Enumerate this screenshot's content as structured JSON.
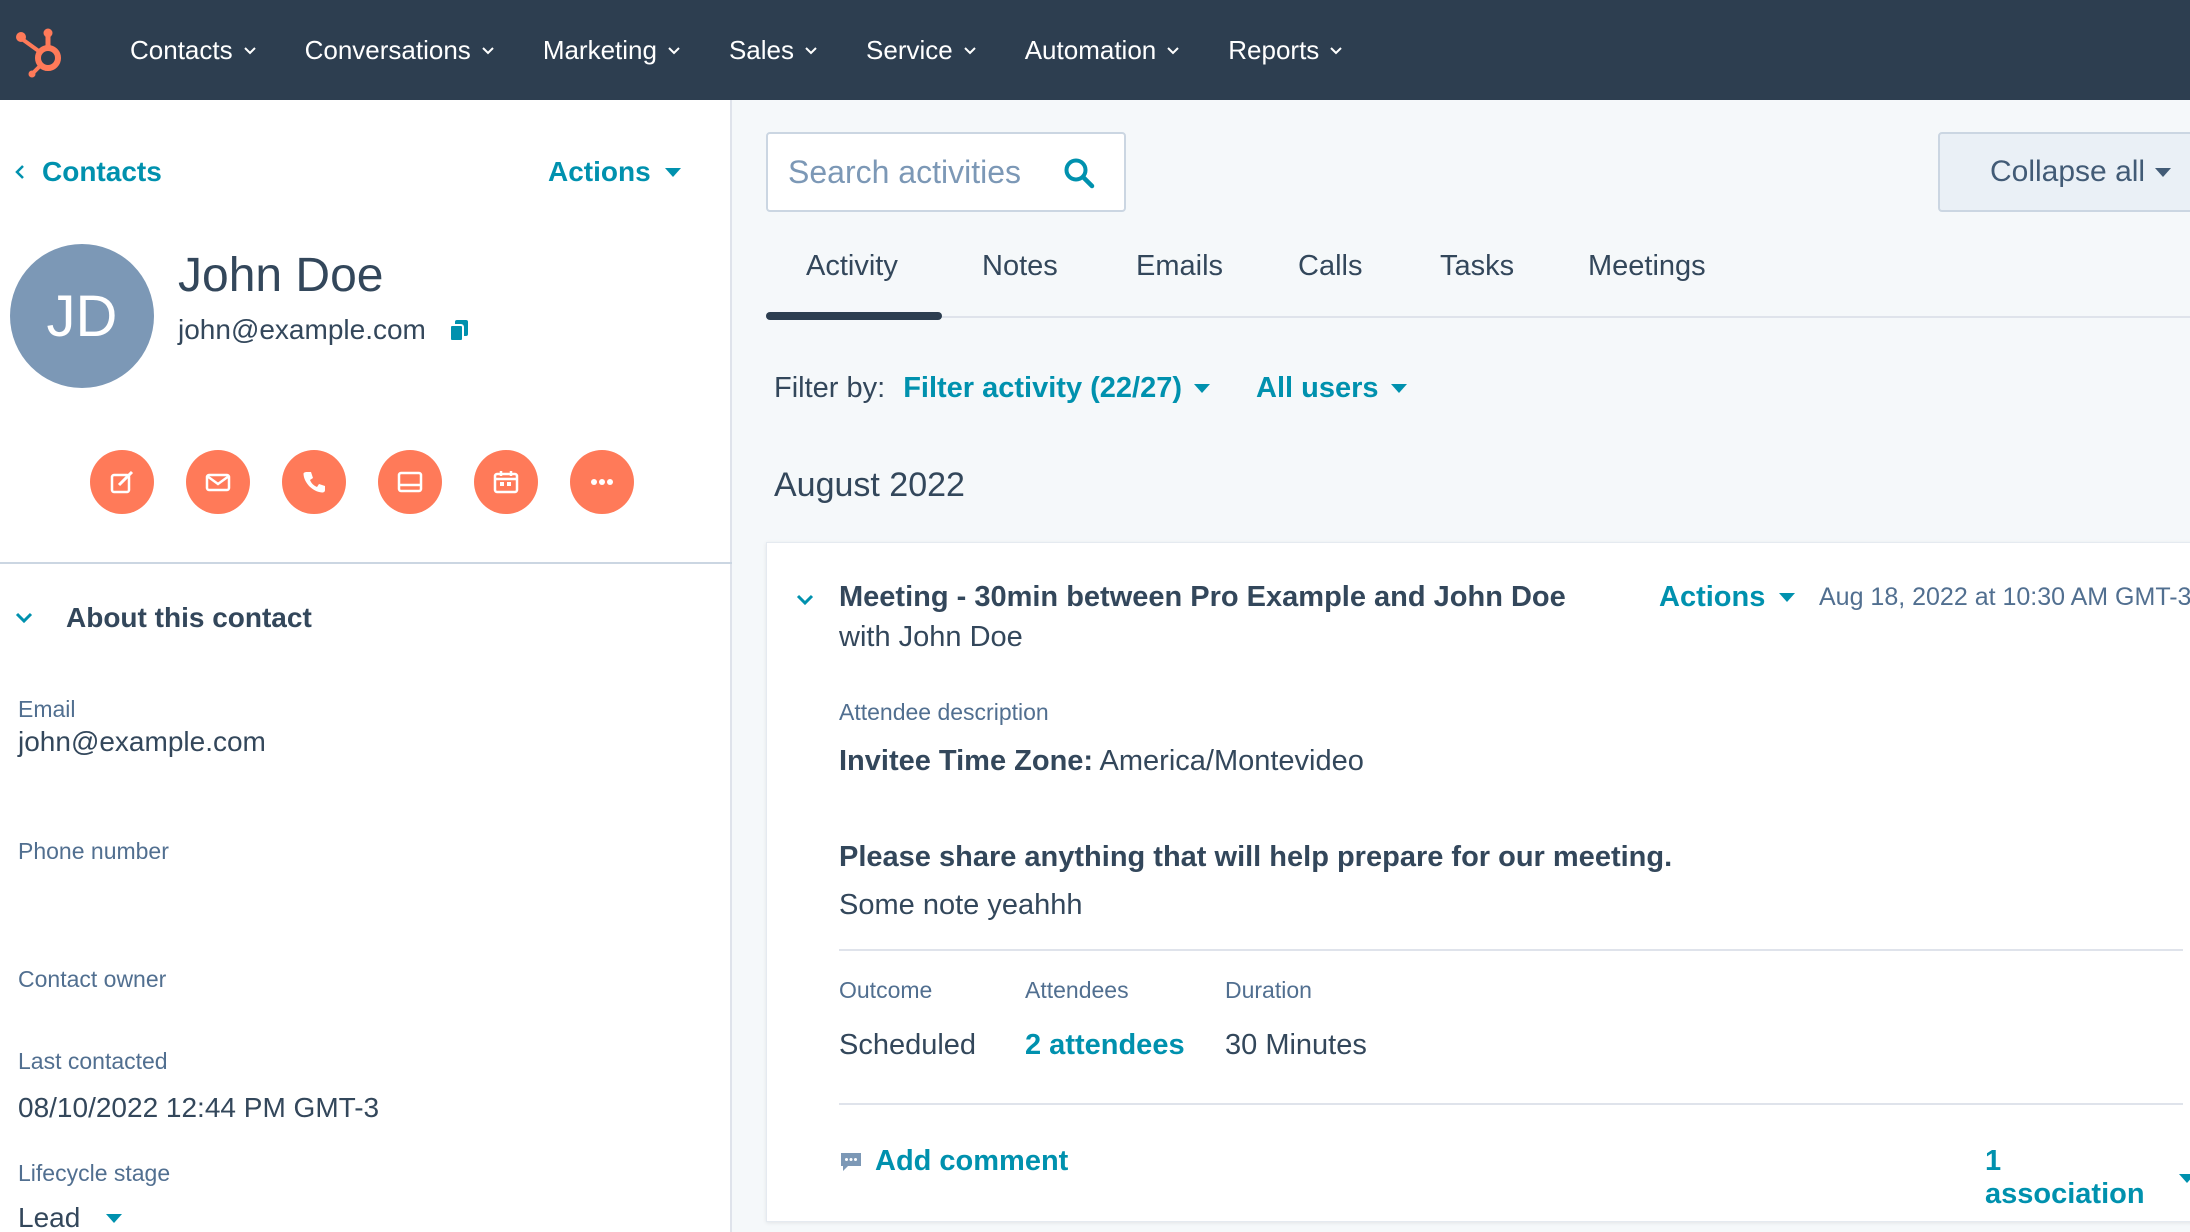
{
  "nav": {
    "items": [
      {
        "label": "Contacts"
      },
      {
        "label": "Conversations"
      },
      {
        "label": "Marketing"
      },
      {
        "label": "Sales"
      },
      {
        "label": "Service"
      },
      {
        "label": "Automation"
      },
      {
        "label": "Reports"
      }
    ]
  },
  "left": {
    "back_label": "Contacts",
    "actions_label": "Actions",
    "avatar_initials": "JD",
    "name": "John Doe",
    "email": "john@example.com",
    "quick_actions": [
      "note-icon",
      "email-icon",
      "call-icon",
      "log-icon",
      "meeting-icon",
      "more-icon"
    ],
    "about_title": "About this contact",
    "props": {
      "email_label": "Email",
      "email_value": "john@example.com",
      "phone_label": "Phone number",
      "owner_label": "Contact owner",
      "last_contacted_label": "Last contacted",
      "last_contacted_value": "08/10/2022 12:44 PM GMT-3",
      "lifecycle_label": "Lifecycle stage",
      "lifecycle_value": "Lead"
    }
  },
  "right": {
    "search_placeholder": "Search activities",
    "collapse_label": "Collapse all",
    "tabs": [
      {
        "label": "Activity",
        "active": true
      },
      {
        "label": "Notes"
      },
      {
        "label": "Emails"
      },
      {
        "label": "Calls"
      },
      {
        "label": "Tasks"
      },
      {
        "label": "Meetings"
      }
    ],
    "filter_label": "Filter by:",
    "filter_activity": "Filter activity (22/27)",
    "filter_users": "All users",
    "month": "August 2022",
    "card": {
      "title": "Meeting - 30min between Pro Example and John Doe",
      "with": "with John Doe",
      "actions_label": "Actions",
      "date": "Aug 18, 2022 at 10:30 AM GMT-3",
      "attendee_desc_label": "Attendee description",
      "tz_label": "Invitee Time Zone:",
      "tz_value": "America/Montevideo",
      "question": "Please share anything that will help prepare for our meeting.",
      "answer": "Some note yeahhh",
      "outcome_label": "Outcome",
      "outcome_value": "Scheduled",
      "attendees_label": "Attendees",
      "attendees_value": "2 attendees",
      "duration_label": "Duration",
      "duration_value": "30 Minutes",
      "add_comment": "Add comment",
      "association": "1 association"
    }
  },
  "colors": {
    "nav_bg": "#2d3e50",
    "accent": "#0091ae",
    "orange": "#ff7a59",
    "avatar": "#7c98b6"
  }
}
